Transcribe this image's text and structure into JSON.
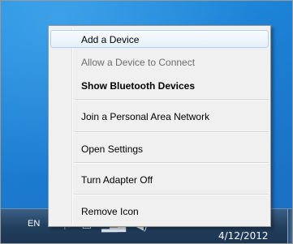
{
  "menu": {
    "items": [
      {
        "label": "Add a Device",
        "state": "highlighted"
      },
      {
        "label": "Allow a Device to Connect",
        "state": "disabled"
      },
      {
        "label": "Show Bluetooth Devices",
        "state": "default-bold"
      },
      {
        "label": "Join a Personal Area Network",
        "state": "normal"
      },
      {
        "label": "Open Settings",
        "state": "normal"
      },
      {
        "label": "Turn Adapter Off",
        "state": "normal"
      },
      {
        "label": "Remove Icon",
        "state": "normal"
      }
    ]
  },
  "taskbar": {
    "language": "EN",
    "date": "4/12/2012",
    "tray_icons": [
      "action-center-icon",
      "network-icon",
      "signal-bars-icon",
      "volume-icon"
    ]
  },
  "colors": {
    "menu_bg": "#f0f0f0",
    "highlight_border": "#aecff7",
    "disabled_text": "#6d6d6d",
    "desktop": "#1c7fd3",
    "taskbar": "#23405f"
  }
}
